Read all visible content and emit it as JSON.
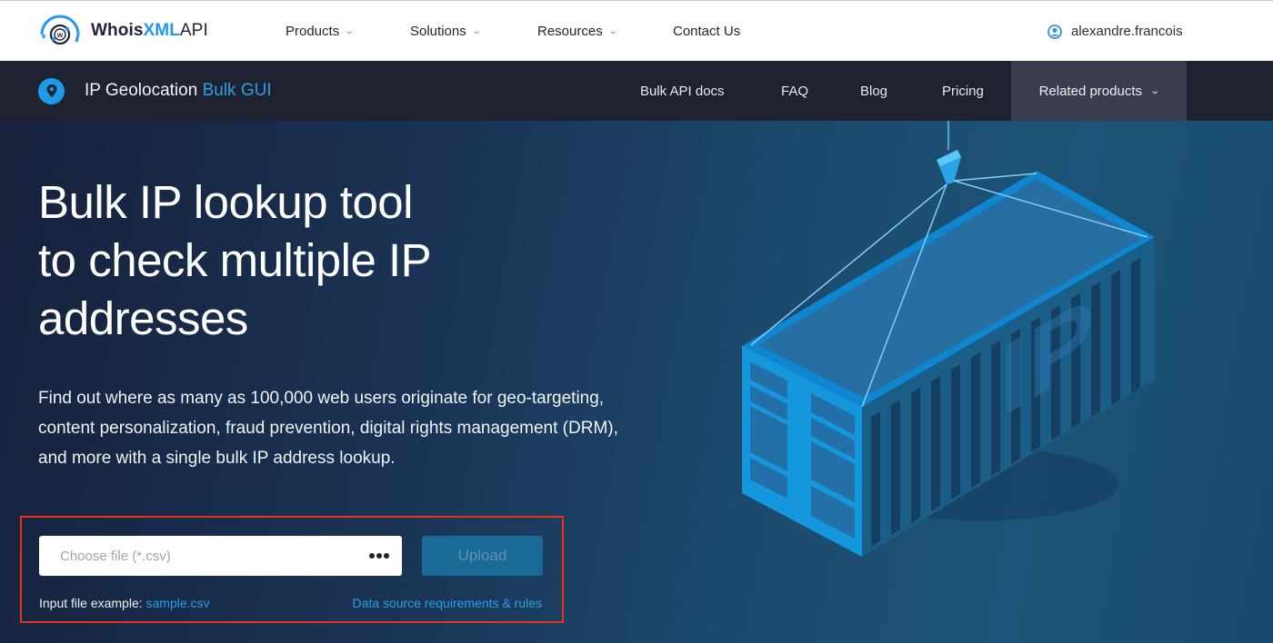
{
  "topbar": {
    "logo": {
      "part1": "Whois",
      "part2": "XML",
      "part3": "API"
    },
    "nav": [
      {
        "label": "Products",
        "has_dropdown": true
      },
      {
        "label": "Solutions",
        "has_dropdown": true
      },
      {
        "label": "Resources",
        "has_dropdown": true
      },
      {
        "label": "Contact Us",
        "has_dropdown": false
      }
    ],
    "user": {
      "name": "alexandre.francois",
      "icon": "user-circle-icon"
    }
  },
  "subbar": {
    "icon": "location-pin-icon",
    "title_main": "IP Geolocation",
    "title_highlight": "Bulk GUI",
    "nav": [
      {
        "label": "Bulk API docs"
      },
      {
        "label": "FAQ"
      },
      {
        "label": "Blog"
      },
      {
        "label": "Pricing"
      }
    ],
    "related": {
      "label": "Related products"
    }
  },
  "hero": {
    "title_lines": [
      "Bulk IP lookup tool",
      "to check multiple IP",
      "addresses"
    ],
    "description_lines": [
      "Find out where as many as 100,000 web users originate for geo-targeting,",
      "content personalization, fraud prevention, digital rights management (DRM),",
      "and more with a single bulk IP address lookup."
    ],
    "illustration_text": "IP"
  },
  "upload": {
    "file_placeholder": "Choose file (*.csv)",
    "browse_icon": "more-dots-icon",
    "upload_label": "Upload",
    "example_label": "Input file example:",
    "example_link": "sample.csv",
    "rules_link": "Data source requirements & rules"
  },
  "colors": {
    "accent": "#2aa0e6",
    "subbar_bg": "#1f2230",
    "highlight_border": "#e8321e"
  }
}
